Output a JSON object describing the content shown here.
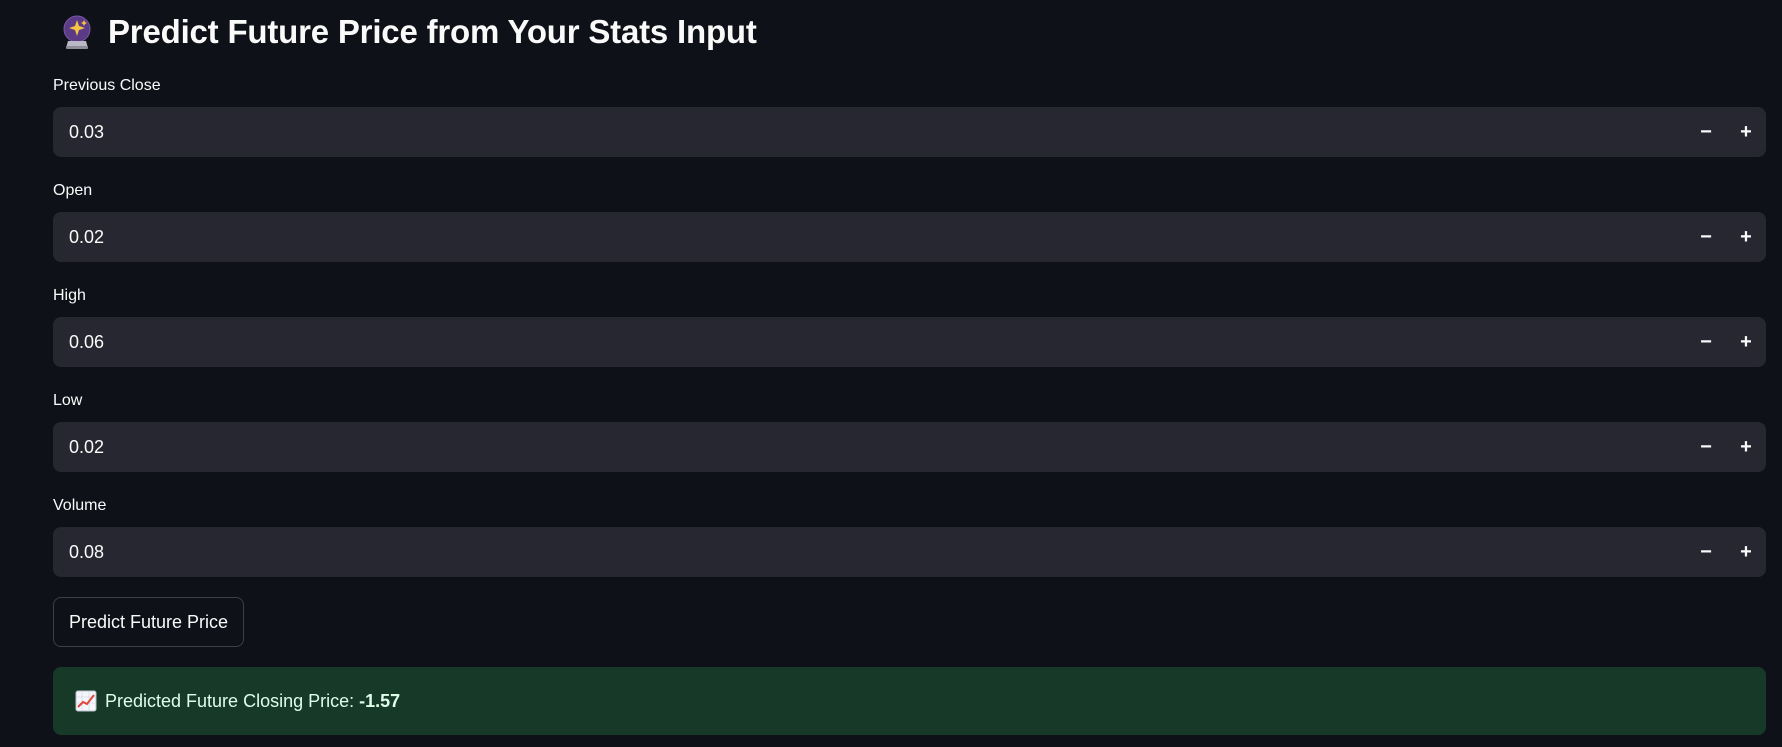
{
  "header": {
    "title": "Predict Future Price from Your Stats Input",
    "icon": "crystal-ball-icon"
  },
  "fields": [
    {
      "label": "Previous Close",
      "value": "0.03"
    },
    {
      "label": "Open",
      "value": "0.02"
    },
    {
      "label": "High",
      "value": "0.06"
    },
    {
      "label": "Low",
      "value": "0.02"
    },
    {
      "label": "Volume",
      "value": "0.08"
    }
  ],
  "stepper": {
    "decrement": "−",
    "increment": "+"
  },
  "predict_button": {
    "label": "Predict Future Price"
  },
  "result": {
    "icon": "chart-increasing-icon",
    "label": "Predicted Future Closing Price:",
    "value": "-1.57"
  },
  "colors": {
    "background": "#0e1117",
    "input_background": "#262730",
    "success_background": "#173928",
    "success_text": "#dffde9"
  }
}
